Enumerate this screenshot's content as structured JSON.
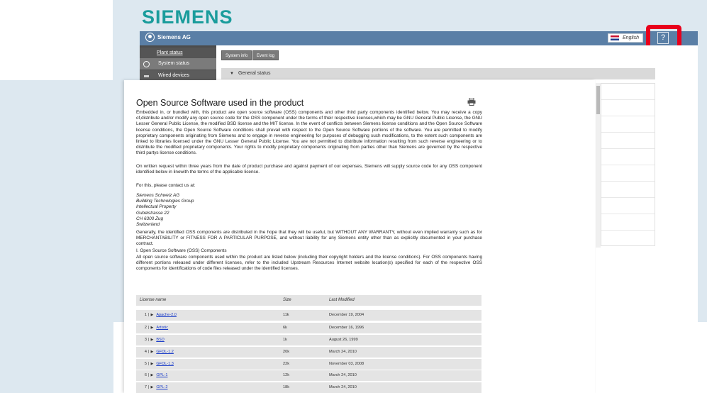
{
  "brand": "SIEMENS",
  "header": {
    "org": "Siemens AG",
    "language": "English",
    "help_glyph": "?"
  },
  "nav": {
    "plant_status": "Plant status",
    "system_status": "System status",
    "wired_devices": "Wired devices"
  },
  "tabs": {
    "system_info": "System info",
    "event_log": "Event log"
  },
  "general_status": "General status",
  "highlight_color": "#e8001c",
  "doc": {
    "title": "Open Source Software used in the product",
    "p1": "Embedded in, or bundled with, this product are open source software (OSS) components and other third party components identified below. You may receive a copy of,distribute and/or modify any open source code for the OSS component under the terms of their respective licenses,which may be GNU General Public License, the GNU Lesser General Public License, the modified BSD license and the MIT license. In the event of conflicts between Siemens license conditions and the Open Source Software license conditions, the Open Source Software conditions shall prevail with respect to the Open Source Software portions of the software. You are permitted to modify proprietary components originating from Siemens and to engage in reverse engineering for purposes of debugging such modifications, to the extent such components are linked to libraries licensed under the GNU Lesser General Public License. You are not permitted to distribute information resulting from such reverse engineering or to distribute the modified proprietary components. Your rights to modify proprietary components originating from parties other than Siemens are governed by the respective third partys license conditions.",
    "p2": "On written request within three years from the date of product purchase and against payment of our expenses, Siemens will supply source code for any OSS component identified below in linewith the terms of the applicable license.",
    "p3": "For this, please contact us at:",
    "address": [
      "Siemens Schweiz AG",
      "Building Technologies Group",
      "Intellectual Property",
      "Gubelstrasse 22",
      "CH 6300 Zug",
      "Switzerland"
    ],
    "p4": "Generally, the identified OSS components are distributed in the hope that they will be useful, but WITHOUT ANY WARRANTY, without even implied warranty such as for MERCHANTABILITY or FITNESS FOR A PARTICULAR PURPOSE, and without liability for any Siemens entity other than as explicitly documented in your purchase contract.",
    "p5": "I. Open Source Software (OSS) Components",
    "p6": "All open source software components used within the product are listed below (including their copyright holders and the license conditions). For OSS components having different portions released under different licenses, refer to the included Upstream Resources Internet website location(s) specified for each of the respective OSS components for identifications of code files released under the identified licenses."
  },
  "table": {
    "headers": [
      "License name",
      "Size",
      "Last Modified"
    ],
    "rows": [
      {
        "num": "1",
        "name": "Apache-2.0",
        "size": "11k",
        "date": "December 19, 2004"
      },
      {
        "num": "2",
        "name": "Artistic",
        "size": "6k",
        "date": "December 16, 1996"
      },
      {
        "num": "3",
        "name": "BSD",
        "size": "1k",
        "date": "August 26, 1999"
      },
      {
        "num": "4",
        "name": "GFDL-1.2",
        "size": "20k",
        "date": "March 24, 2010"
      },
      {
        "num": "5",
        "name": "GFDL-1.3",
        "size": "22k",
        "date": "November 03, 2008"
      },
      {
        "num": "6",
        "name": "GPL-1",
        "size": "12k",
        "date": "March 24, 2010"
      },
      {
        "num": "7",
        "name": "GPL-2",
        "size": "18k",
        "date": "March 24, 2010"
      }
    ]
  }
}
